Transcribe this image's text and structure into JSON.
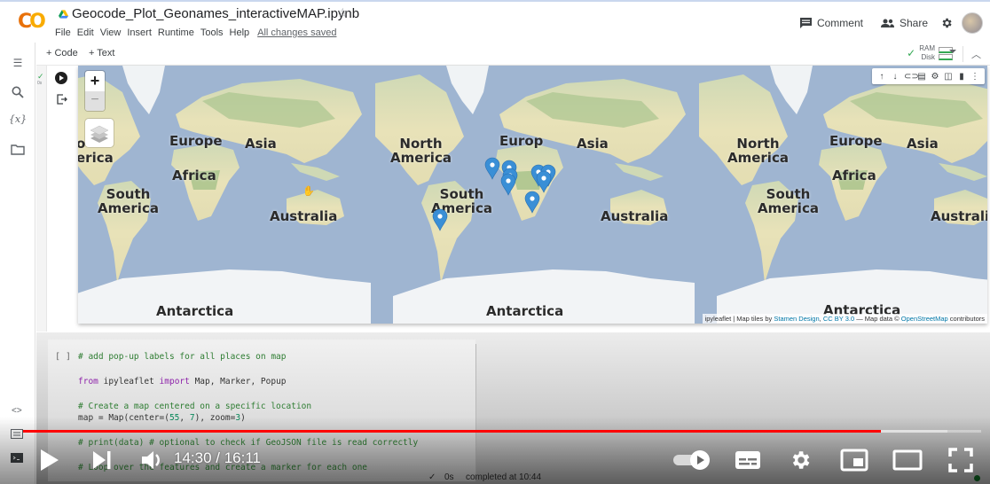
{
  "header": {
    "logo": "CO",
    "title": "Geocode_Plot_Geonames_interactiveMAP.ipynb",
    "menu": [
      "File",
      "Edit",
      "View",
      "Insert",
      "Runtime",
      "Tools",
      "Help"
    ],
    "save_status": "All changes saved",
    "comment_label": "Comment",
    "share_label": "Share"
  },
  "toolbar": {
    "add_code": "+ Code",
    "add_text": "+ Text",
    "ram_label": "RAM",
    "disk_label": "Disk"
  },
  "cell_output": {
    "exec_time": "0s",
    "cell_tools": [
      "move-up",
      "move-down",
      "link",
      "comment",
      "settings",
      "mirror",
      "delete",
      "more"
    ],
    "map": {
      "zoom_in": "+",
      "zoom_out": "−",
      "labels": [
        {
          "text": "Europe",
          "id": "europe-1"
        },
        {
          "text": "Asia",
          "id": "asia-1"
        },
        {
          "text": "Africa",
          "id": "africa-1"
        },
        {
          "text": "South\nAmerica",
          "id": "south-america-1"
        },
        {
          "text": "Australia",
          "id": "australia-1"
        },
        {
          "text": "Antarctica",
          "id": "antarctica-1"
        },
        {
          "text": "North\nAmerica",
          "id": "north-america-2"
        },
        {
          "text": "South\nAmerica",
          "id": "south-america-2"
        },
        {
          "text": "Europ",
          "id": "europe-2"
        },
        {
          "text": "Asia",
          "id": "asia-2"
        },
        {
          "text": "Australia",
          "id": "australia-2"
        },
        {
          "text": "Antarctica",
          "id": "antarctica-2"
        },
        {
          "text": "North\nAmerica",
          "id": "north-america-3"
        },
        {
          "text": "Europe",
          "id": "europe-3"
        },
        {
          "text": "Asia",
          "id": "asia-3"
        },
        {
          "text": "Africa",
          "id": "africa-3"
        },
        {
          "text": "South\nAmerica",
          "id": "south-america-3"
        },
        {
          "text": "Australia",
          "id": "australia-3"
        },
        {
          "text": "Antarctica",
          "id": "antarctica-3"
        },
        {
          "text": "o\nerica",
          "id": "america-edge"
        }
      ],
      "attribution": {
        "prefix": "ipyleaflet | Map tiles by ",
        "stamen": "Stamen Design",
        "sep": ", ",
        "license": "CC BY 3.0",
        "mid": " — Map data © ",
        "osm": "OpenStreetMap",
        "suffix": " contributors"
      },
      "marker_color": "#3a8fd6",
      "marker_count": 9
    }
  },
  "code_cell": {
    "bracket": "[ ]",
    "lines": [
      {
        "kind": "comment",
        "text": "# add pop-up labels for all places on map"
      },
      {
        "kind": "import",
        "kw1": "from",
        "mod": " ipyleaflet ",
        "kw2": "import",
        "rest": " Map, Marker, Popup"
      },
      {
        "kind": "comment",
        "text": "# Create a map centered on a specific location"
      },
      {
        "kind": "code",
        "pre": "map = Map(center=(",
        "n1": "55",
        "mid": ", ",
        "n2": "7",
        "mid2": "), zoom=",
        "n3": "3",
        "post": ")"
      },
      {
        "kind": "comment",
        "text": "# print(data) # optional to check if GeoJSON file is read correctly"
      },
      {
        "kind": "comment",
        "text": "# Loop over the features and create a marker for each one"
      }
    ]
  },
  "video": {
    "current_time": "14:30",
    "duration": "16:11",
    "time_display": "14:30 / 16:11",
    "played_fraction": 0.895,
    "buffered_fraction": 0.965
  },
  "status": {
    "check": "✓",
    "duration": "0s",
    "message": "completed at 10:44"
  }
}
